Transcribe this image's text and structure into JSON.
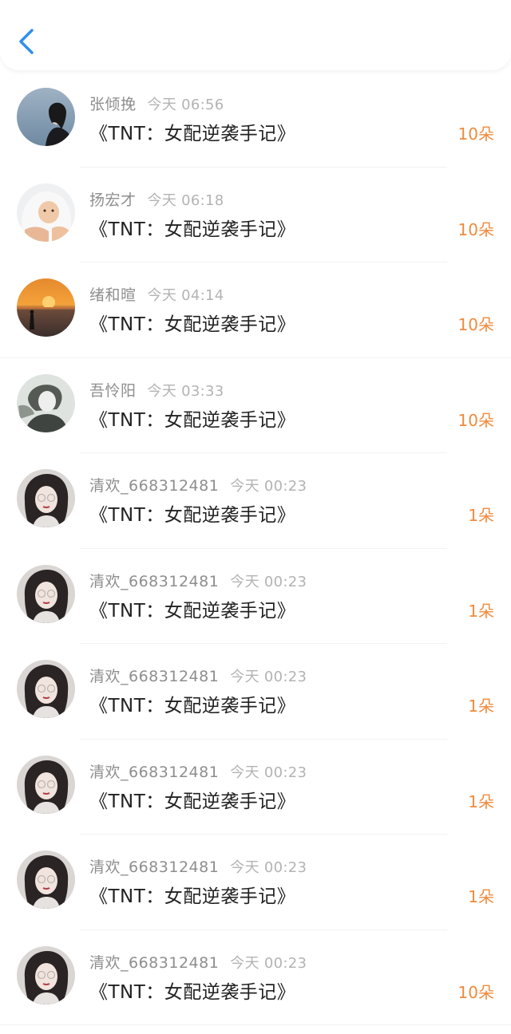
{
  "header": {
    "back_icon": "chevron-left-icon",
    "accent": "#2e8ff0"
  },
  "colors": {
    "count": "#f08a3c",
    "username": "#8e8e8e",
    "time": "#b3b3b3",
    "title": "#222222"
  },
  "rows": [
    {
      "username": "张倾挽",
      "time": "今天 06:56",
      "title": "《TNT：女配逆袭手记》",
      "count": "10朵",
      "avatar": "girl-sky-avatar"
    },
    {
      "username": "扬宏才",
      "time": "今天 06:18",
      "title": "《TNT：女配逆袭手记》",
      "count": "10朵",
      "avatar": "baby-towel-avatar"
    },
    {
      "username": "绪和暄",
      "time": "今天 04:14",
      "title": "《TNT：女配逆袭手记》",
      "count": "10朵",
      "avatar": "sunset-sea-avatar"
    },
    {
      "username": "吾怜阳",
      "time": "今天 03:33",
      "title": "《TNT：女配逆袭手记》",
      "count": "10朵",
      "avatar": "sketch-boy-avatar"
    },
    {
      "username": "清欢_668312481",
      "time": "今天 00:23",
      "title": "《TNT：女配逆袭手记》",
      "count": "1朵",
      "avatar": "girl-glasses-avatar"
    },
    {
      "username": "清欢_668312481",
      "time": "今天 00:23",
      "title": "《TNT：女配逆袭手记》",
      "count": "1朵",
      "avatar": "girl-glasses-avatar"
    },
    {
      "username": "清欢_668312481",
      "time": "今天 00:23",
      "title": "《TNT：女配逆袭手记》",
      "count": "1朵",
      "avatar": "girl-glasses-avatar"
    },
    {
      "username": "清欢_668312481",
      "time": "今天 00:23",
      "title": "《TNT：女配逆袭手记》",
      "count": "1朵",
      "avatar": "girl-glasses-avatar"
    },
    {
      "username": "清欢_668312481",
      "time": "今天 00:23",
      "title": "《TNT：女配逆袭手记》",
      "count": "1朵",
      "avatar": "girl-glasses-avatar"
    },
    {
      "username": "清欢_668312481",
      "time": "今天 00:23",
      "title": "《TNT：女配逆袭手记》",
      "count": "10朵",
      "avatar": "girl-glasses-avatar"
    }
  ]
}
